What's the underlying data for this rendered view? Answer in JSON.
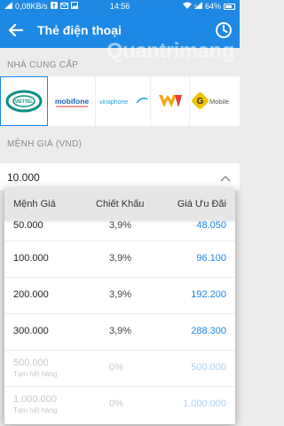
{
  "status_bar": {
    "net_speed": "0,08KB/s",
    "time": "14:56",
    "battery": "64%"
  },
  "header": {
    "title": "Thẻ điện thoại"
  },
  "carriers": {
    "label": "NHÀ CUNG CẤP",
    "items": [
      {
        "name": "VIETTEL",
        "selected": true
      },
      {
        "name": "mobifone",
        "selected": false
      },
      {
        "name": "vinaphone",
        "selected": false
      },
      {
        "name": "VM",
        "selected": false
      },
      {
        "name": "Mobile",
        "selected": false
      }
    ]
  },
  "denomination": {
    "label": "MỆNH GIÁ (VND)",
    "value": "10.000"
  },
  "table": {
    "headers": {
      "denomination": "Mệnh Giá",
      "discount": "Chiết Khấu",
      "price": "Giá Ưu Đãi"
    },
    "rows": [
      {
        "denomination": "50.000",
        "discount": "3,9%",
        "price": "48.050"
      },
      {
        "denomination": "100.000",
        "discount": "3,9%",
        "price": "96.100"
      },
      {
        "denomination": "200.000",
        "discount": "3,9%",
        "price": "192.200"
      },
      {
        "denomination": "300.000",
        "discount": "3,9%",
        "price": "288.300"
      },
      {
        "denomination": "500.000",
        "note": "Tạm hết hàng",
        "discount": "0%",
        "price": "500.000"
      },
      {
        "denomination": "1.000.000",
        "note": "Tạm hết hàng",
        "discount": "0%",
        "price": "1.000.000"
      }
    ]
  },
  "watermark": "Quantrimang",
  "colors": {
    "primary": "#1e88e5",
    "viettel": "#0a8f83",
    "mobifone": "#1763b8",
    "vinaphone": "#1aa3e0",
    "vietnamobile": "#f3a712",
    "gmobile": "#f2c200"
  }
}
